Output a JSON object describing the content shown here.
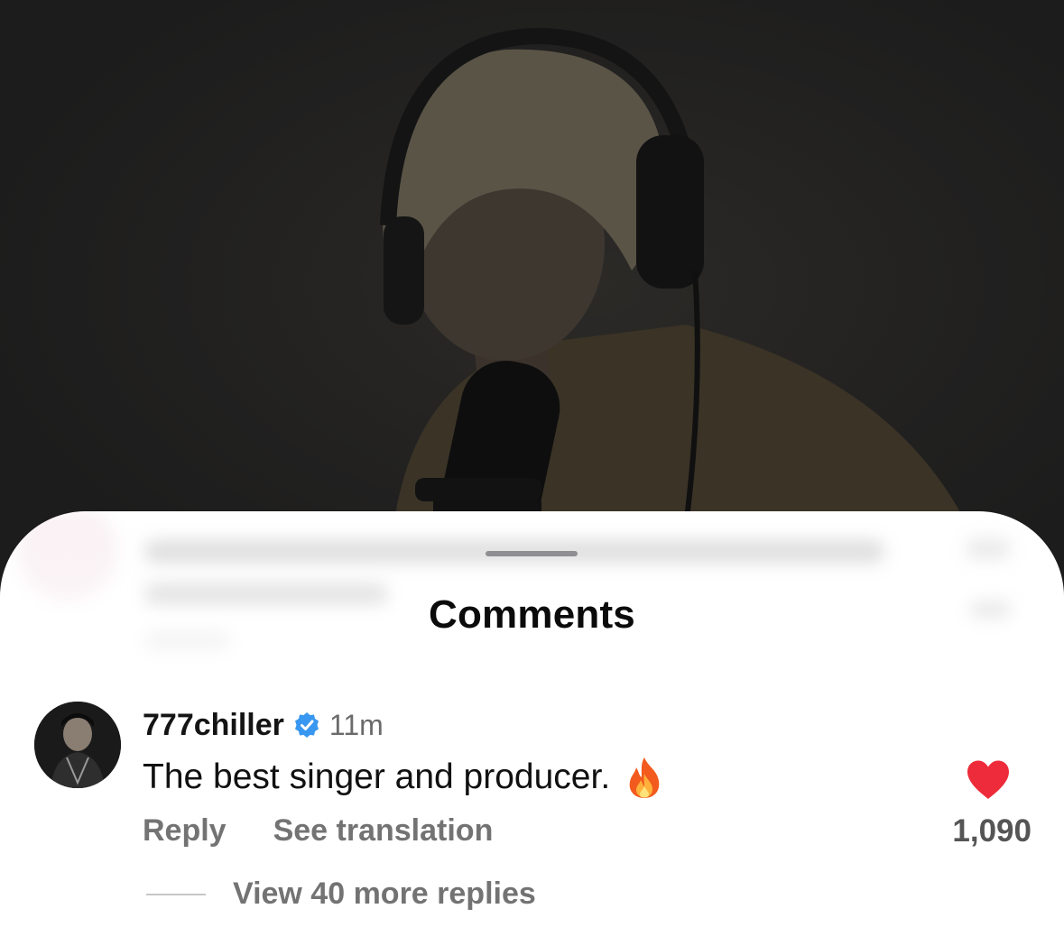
{
  "sheet": {
    "title": "Comments"
  },
  "comment": {
    "username": "777chiller",
    "timestamp": "11m",
    "text": "The best singer and producer.",
    "emoji_icon": "fire-emoji-icon",
    "reply_label": "Reply",
    "translate_label": "See translation",
    "like_count": "1,090",
    "liked": true,
    "view_more_label": "View 40 more replies"
  },
  "colors": {
    "heart": "#ed2b3a",
    "verified_badge": "#3897f0"
  }
}
